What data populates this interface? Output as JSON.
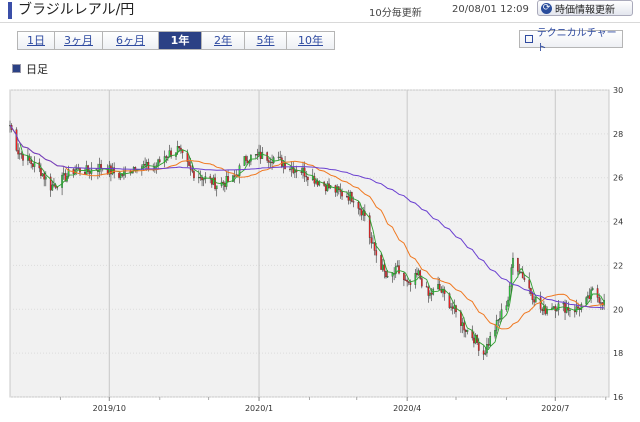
{
  "header": {
    "title": "ブラジルレアル/円",
    "update_note": "10分毎更新",
    "update_time": "20/08/01 12:09",
    "refresh_button": "時価情報更新"
  },
  "range_tabs": [
    {
      "label": "1日",
      "active": false
    },
    {
      "label": "3ヶ月",
      "active": false
    },
    {
      "label": "6ヶ月",
      "active": false
    },
    {
      "label": "1年",
      "active": true
    },
    {
      "label": "2年",
      "active": false
    },
    {
      "label": "5年",
      "active": false
    },
    {
      "label": "10年",
      "active": false
    }
  ],
  "technical_chart_button": "テクニカルチャート",
  "section_label": "日足",
  "colors": {
    "accent": "#2b4185",
    "candle_up": "#2ecc40",
    "candle_down": "#ee2020",
    "ma_short": "#2ea02e",
    "ma_mid": "#f07820",
    "ma_long": "#6a3fd0",
    "plot_bg": "#f1f1f1"
  },
  "chart_data": {
    "type": "candlestick",
    "ylim": [
      16,
      30
    ],
    "yticks": [
      16,
      18,
      20,
      22,
      24,
      26,
      28,
      30
    ],
    "xtick_labels": [
      "2019/10",
      "2020/1",
      "2020/4",
      "2020/7"
    ],
    "close_anchors": [
      [
        "2019-08-01",
        28.4
      ],
      [
        "2019-08-06",
        27.2
      ],
      [
        "2019-08-12",
        26.8
      ],
      [
        "2019-08-20",
        26.3
      ],
      [
        "2019-08-26",
        25.6
      ],
      [
        "2019-09-02",
        25.9
      ],
      [
        "2019-09-10",
        26.4
      ],
      [
        "2019-09-18",
        26.3
      ],
      [
        "2019-09-26",
        26.5
      ],
      [
        "2019-10-08",
        26.1
      ],
      [
        "2019-10-18",
        26.6
      ],
      [
        "2019-10-28",
        26.4
      ],
      [
        "2019-11-04",
        27.0
      ],
      [
        "2019-11-12",
        27.3
      ],
      [
        "2019-11-20",
        26.3
      ],
      [
        "2019-11-28",
        26.0
      ],
      [
        "2019-12-06",
        25.7
      ],
      [
        "2019-12-16",
        25.9
      ],
      [
        "2019-12-24",
        26.9
      ],
      [
        "2020-01-02",
        27.0
      ],
      [
        "2020-01-10",
        26.9
      ],
      [
        "2020-01-20",
        26.5
      ],
      [
        "2020-01-28",
        26.3
      ],
      [
        "2020-02-05",
        25.9
      ],
      [
        "2020-02-12",
        25.6
      ],
      [
        "2020-02-20",
        25.3
      ],
      [
        "2020-02-28",
        25.1
      ],
      [
        "2020-03-06",
        24.3
      ],
      [
        "2020-03-10",
        23.0
      ],
      [
        "2020-03-16",
        22.0
      ],
      [
        "2020-03-20",
        21.3
      ],
      [
        "2020-03-26",
        21.8
      ],
      [
        "2020-04-02",
        21.0
      ],
      [
        "2020-04-08",
        21.6
      ],
      [
        "2020-04-14",
        20.6
      ],
      [
        "2020-04-20",
        21.0
      ],
      [
        "2020-04-27",
        20.3
      ],
      [
        "2020-05-05",
        19.3
      ],
      [
        "2020-05-12",
        18.7
      ],
      [
        "2020-05-18",
        18.0
      ],
      [
        "2020-05-26",
        19.3
      ],
      [
        "2020-06-02",
        20.5
      ],
      [
        "2020-06-05",
        22.3
      ],
      [
        "2020-06-10",
        21.7
      ],
      [
        "2020-06-16",
        20.8
      ],
      [
        "2020-06-23",
        19.9
      ],
      [
        "2020-06-29",
        20.2
      ],
      [
        "2020-07-06",
        20.1
      ],
      [
        "2020-07-14",
        20.0
      ],
      [
        "2020-07-21",
        20.4
      ],
      [
        "2020-07-24",
        20.8
      ],
      [
        "2020-07-31",
        20.3
      ]
    ]
  }
}
